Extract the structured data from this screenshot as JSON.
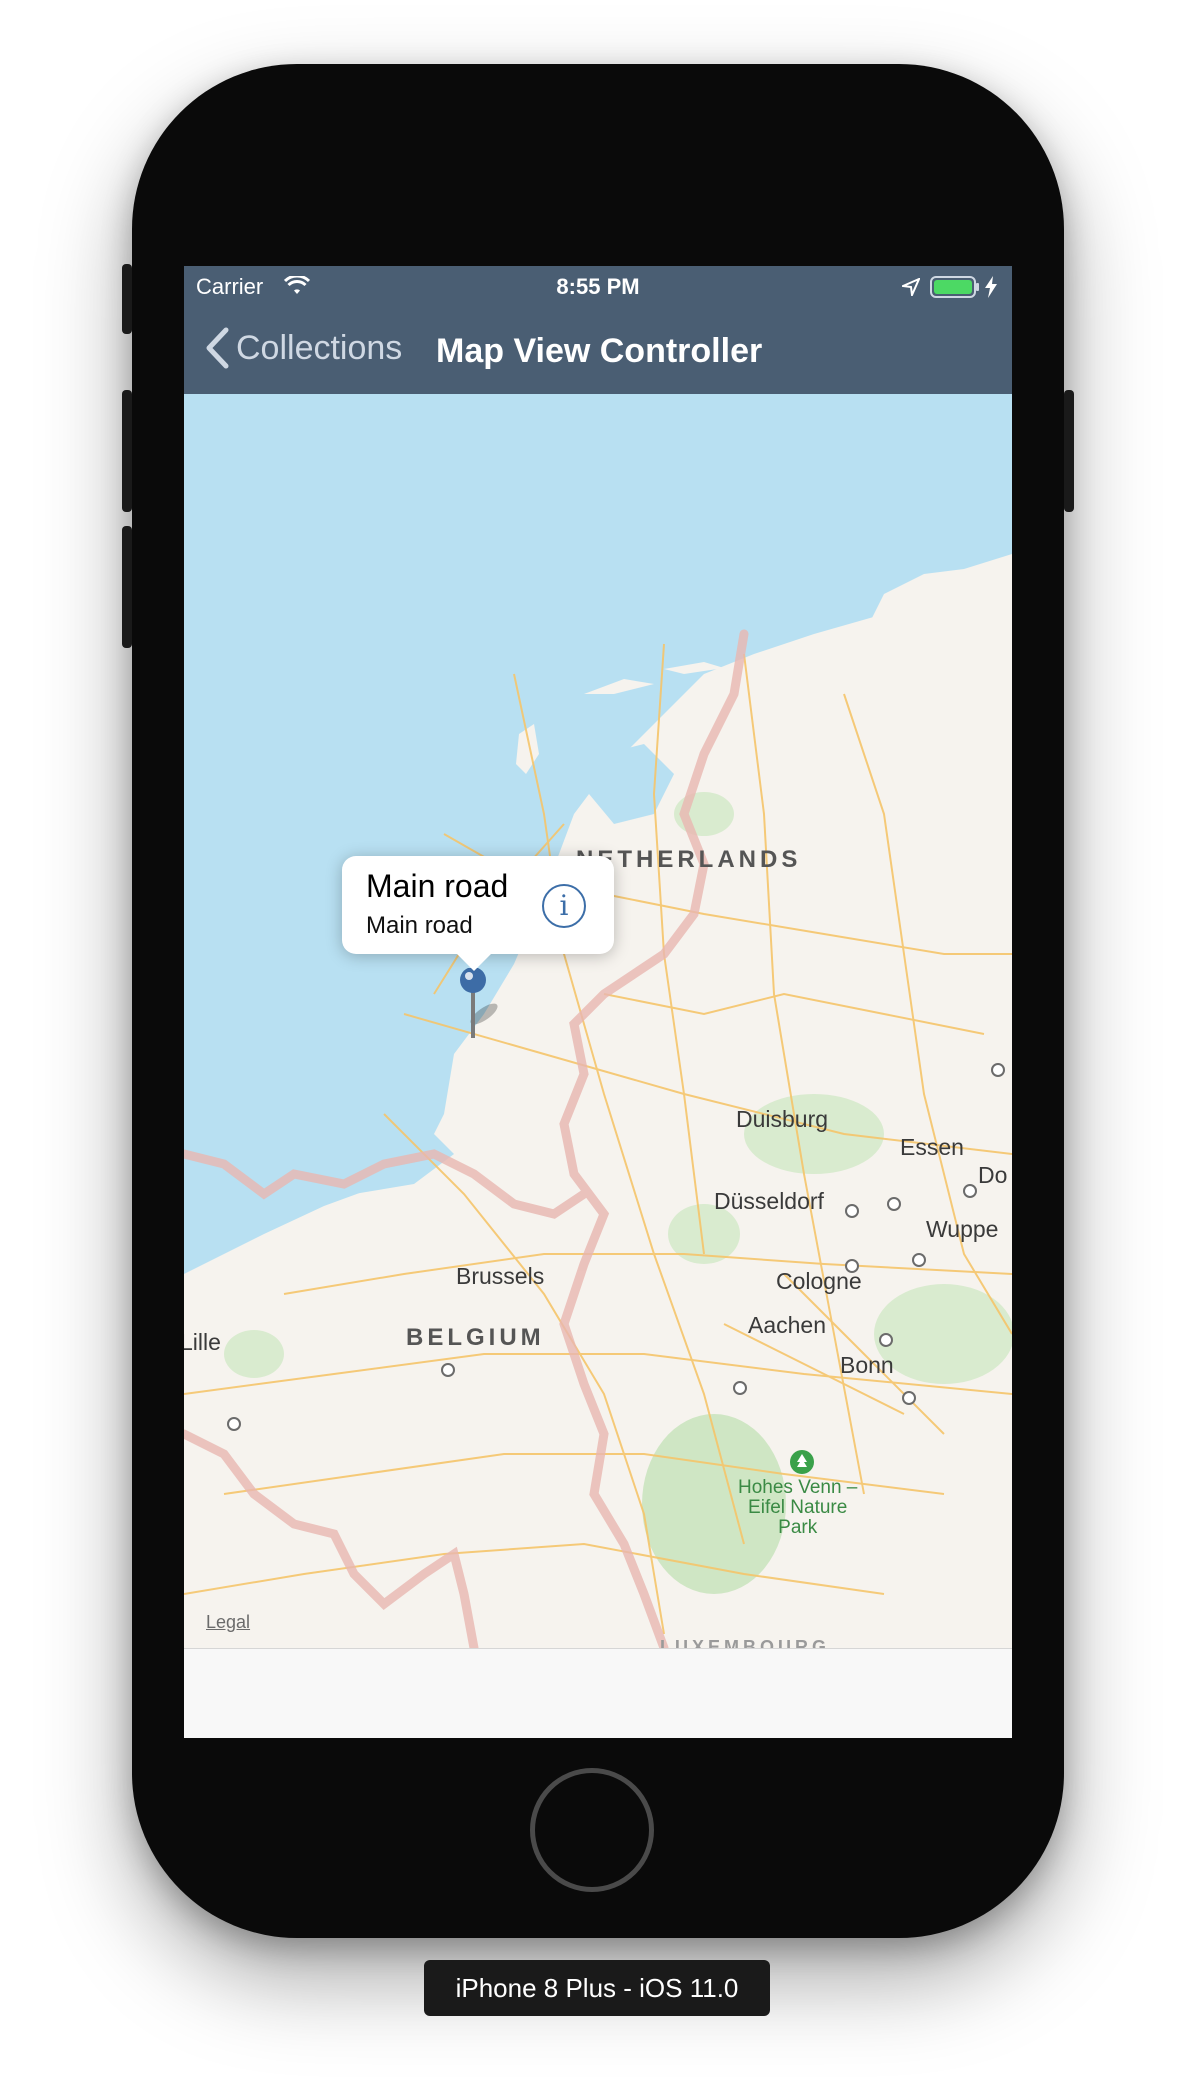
{
  "status_bar": {
    "carrier": "Carrier",
    "time": "8:55 PM",
    "icons": [
      "wifi-icon",
      "location-arrow-icon",
      "battery-icon",
      "charging-bolt-icon"
    ]
  },
  "nav_bar": {
    "back_label": "Collections",
    "title": "Map View Controller"
  },
  "map": {
    "countries": [
      "NETHERLANDS",
      "BELGIUM",
      "LUXEMBOURG"
    ],
    "cities": [
      "Brussels",
      "Lille",
      "Duisburg",
      "Essen",
      "Düsseldorf",
      "Wuppe",
      "Cologne",
      "Aachen",
      "Bonn",
      "Do"
    ],
    "park_label": "Hohes Venn –\nEifel Nature\nPark",
    "legal": "Legal",
    "callout": {
      "title": "Main road",
      "subtitle": "Main road",
      "info_glyph": "i"
    },
    "colors": {
      "water": "#b8e0f2",
      "land": "#f6f3ee",
      "roads": "#f5c56b",
      "border": "#e8b6b0",
      "park": "#cfe6c4",
      "pin": "#3d6ca6"
    }
  },
  "device": {
    "label": "iPhone 8 Plus - iOS 11.0"
  }
}
